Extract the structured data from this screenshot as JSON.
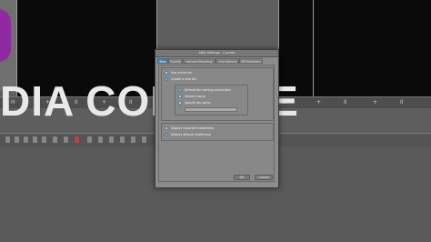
{
  "background": {
    "overlay_text": "DIA CONSOLE",
    "transport_left": [
      "H",
      "+",
      "II",
      "+",
      "II",
      "+",
      "II",
      "+"
    ],
    "transport_right": [
      "H",
      "+",
      "II",
      "+",
      "II",
      "+",
      "II"
    ]
  },
  "dialog": {
    "title": "AMA Settings - Current",
    "tabs": [
      "Bins",
      "Quality",
      "Volume Mounting",
      "Link Options",
      "AR Metadata"
    ],
    "active_tab": "Bins",
    "options": {
      "use_active_bin": "Use active bin",
      "create_new_bin": "Create a new bin",
      "default_bin_naming": "Default bin naming convention",
      "volume_name": "Volume name",
      "specify_bin_name": "Specify bin name",
      "bin_name_value": "",
      "display_imported_headframe": "Display imported headframe",
      "display_default_headframe": "Display default headframe"
    },
    "ok_label": "OK",
    "cancel_label": "Cancel"
  },
  "colors": {
    "accent": "#3f7fb5",
    "dialog_bg": "#8c8c8c",
    "overlay_purple": "#8f2aa0"
  }
}
